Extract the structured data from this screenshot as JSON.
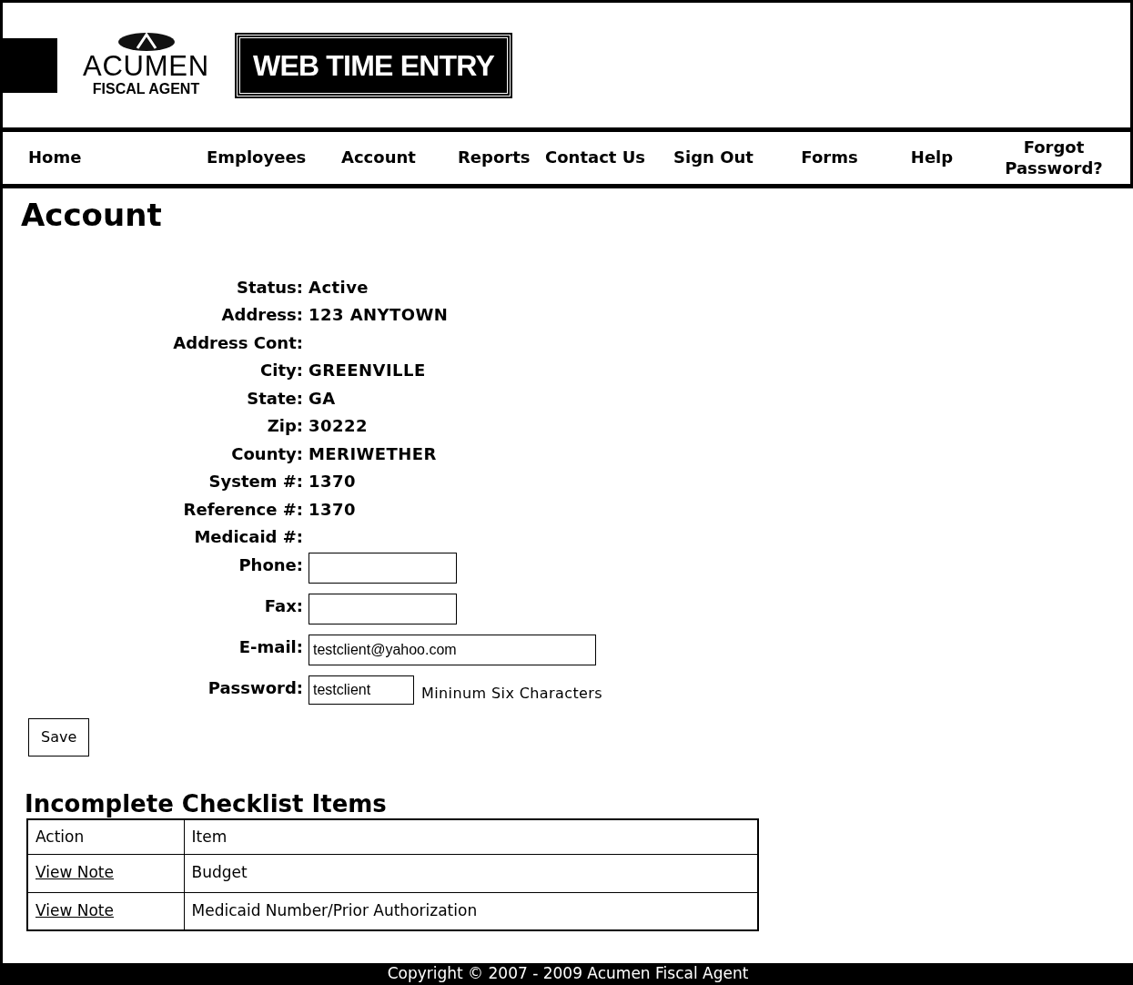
{
  "header": {
    "logo_name": "ACUMEN",
    "logo_sub": "FISCAL AGENT",
    "banner": "WEB TIME ENTRY"
  },
  "nav": [
    {
      "label": "Home"
    },
    {
      "label": "Employees"
    },
    {
      "label": "Account"
    },
    {
      "label": "Reports"
    },
    {
      "label": "Contact Us"
    },
    {
      "label": "Sign Out"
    },
    {
      "label": "Forms"
    },
    {
      "label": "Help"
    },
    {
      "label": "Forgot Password?"
    }
  ],
  "page_title": "Account",
  "fields": [
    {
      "kind": "text",
      "label": "Status:",
      "value": "Active"
    },
    {
      "kind": "text",
      "label": "Address:",
      "value": "123 ANYTOWN"
    },
    {
      "kind": "text",
      "label": "Address Cont:"
    },
    {
      "kind": "text",
      "label": "City:",
      "value": "GREENVILLE"
    },
    {
      "kind": "text",
      "label": "State:",
      "value": "GA"
    },
    {
      "kind": "text",
      "label": "Zip:",
      "value": "30222"
    },
    {
      "kind": "text",
      "label": "County:",
      "value": "MERIWETHER"
    },
    {
      "kind": "text",
      "label": "System #:",
      "value": "1370"
    },
    {
      "kind": "text",
      "label": "Reference #:",
      "value": "1370"
    },
    {
      "kind": "text",
      "label": "Medicaid #:"
    },
    {
      "kind": "input",
      "label": "Phone:"
    },
    {
      "kind": "input",
      "label": "Fax:"
    },
    {
      "kind": "wide_input",
      "label": "E-mail:",
      "value": "testclient@yahoo.com"
    },
    {
      "kind": "password",
      "label": "Password:",
      "value": "testclient",
      "hint": "Mininum Six Characters"
    }
  ],
  "save_button": "Save",
  "checklist": {
    "title": "Incomplete Checklist Items",
    "columns": [
      "Action",
      "Item"
    ],
    "rows": [
      {
        "action": "View Note",
        "item": "Budget"
      },
      {
        "action": "View Note",
        "item": "Medicaid Number/Prior Authorization"
      }
    ]
  },
  "footer": "Copyright © 2007 - 2009 Acumen Fiscal Agent"
}
